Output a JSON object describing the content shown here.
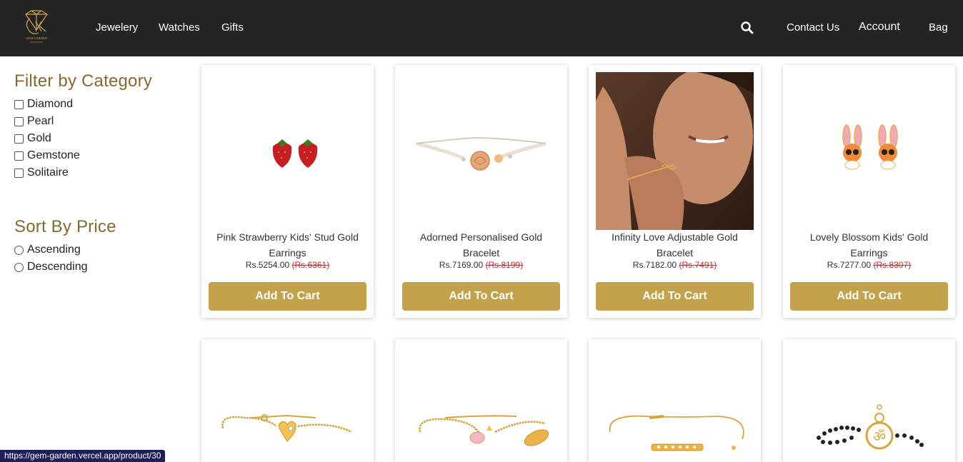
{
  "header": {
    "logo_text": "GEM GARDEN",
    "nav": [
      "Jewelery",
      "Watches",
      "Gifts"
    ],
    "contact": "Contact Us",
    "account": "Account",
    "bag": "Bag"
  },
  "sidebar": {
    "filter_title": "Filter by Category",
    "categories": [
      "Diamond",
      "Pearl",
      "Gold",
      "Gemstone",
      "Solitaire"
    ],
    "sort_title": "Sort By Price",
    "sort_options": [
      "Ascending",
      "Descending"
    ]
  },
  "products": [
    {
      "name": "Pink Strawberry Kids' Stud Gold Earrings",
      "price": "Rs.5254.00",
      "old_price": "(Rs.6361)",
      "button": "Add To Cart"
    },
    {
      "name": "Adorned Personalised Gold Bracelet",
      "price": "Rs.7169.00",
      "old_price": "(Rs.8199)",
      "button": "Add To Cart"
    },
    {
      "name": "Infinity Love Adjustable Gold Bracelet",
      "price": "Rs.7182.00",
      "old_price": "(Rs.7491)",
      "button": "Add To Cart"
    },
    {
      "name": "Lovely Blossom Kids' Gold Earrings",
      "price": "Rs.7277.00",
      "old_price": "(Rs.8307)",
      "button": "Add To Cart"
    }
  ],
  "status_url": "https://gem-garden.vercel.app/product/30",
  "colors": {
    "header": "#242424",
    "accent": "#c3a24b",
    "title": "#86692f",
    "old_price": "#e02020"
  }
}
